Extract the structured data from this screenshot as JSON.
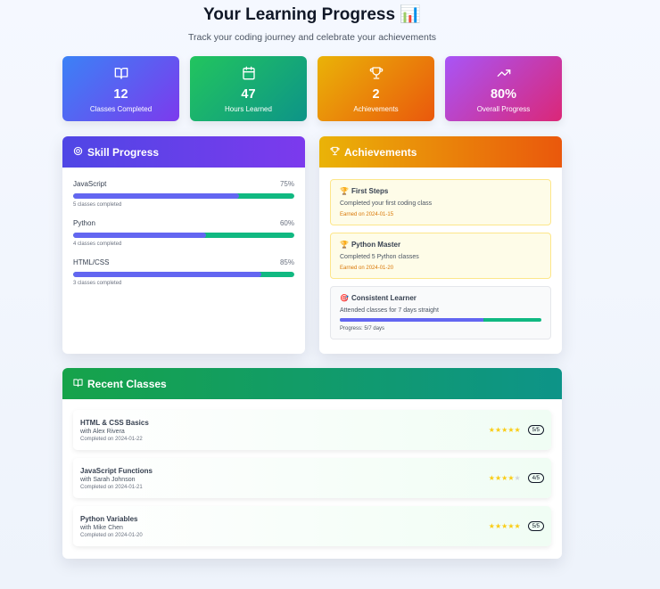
{
  "header": {
    "title": "Your Learning Progress 📊",
    "subtitle": "Track your coding journey and celebrate your achievements"
  },
  "stats": [
    {
      "value": "12",
      "label": "Classes Completed",
      "icon": "book-open-icon"
    },
    {
      "value": "47",
      "label": "Hours Learned",
      "icon": "calendar-icon"
    },
    {
      "value": "2",
      "label": "Achievements",
      "icon": "trophy-icon"
    },
    {
      "value": "80%",
      "label": "Overall Progress",
      "icon": "trending-up-icon"
    }
  ],
  "skills": {
    "title": "Skill Progress",
    "items": [
      {
        "name": "JavaScript",
        "percent_label": "75%",
        "progress": 0.75,
        "note": "5 classes completed"
      },
      {
        "name": "Python",
        "percent_label": "60%",
        "progress": 0.6,
        "note": "4 classes completed"
      },
      {
        "name": "HTML/CSS",
        "percent_label": "85%",
        "progress": 0.85,
        "note": "3 classes completed"
      }
    ]
  },
  "achievements": {
    "title": "Achievements",
    "items": [
      {
        "emoji": "🏆",
        "title": "First Steps",
        "desc": "Completed your first coding class",
        "earned": "Earned on 2024-01-15"
      },
      {
        "emoji": "🏆",
        "title": "Python Master",
        "desc": "Completed 5 Python classes",
        "earned": "Earned on 2024-01-20"
      },
      {
        "emoji": "🎯",
        "title": "Consistent Learner",
        "desc": "Attended classes for 7 days straight",
        "progress_label": "Progress: 5/7 days",
        "progress": 0.714
      }
    ]
  },
  "recent": {
    "title": "Recent Classes",
    "items": [
      {
        "name": "HTML & CSS Basics",
        "teacher": "with Alex Rivera",
        "date": "Completed on 2024-01-22",
        "rating": 5,
        "rating_label": "5/5"
      },
      {
        "name": "JavaScript Functions",
        "teacher": "with Sarah Johnson",
        "date": "Completed on 2024-01-21",
        "rating": 4,
        "rating_label": "4/5"
      },
      {
        "name": "Python Variables",
        "teacher": "with Mike Chen",
        "date": "Completed on 2024-01-20",
        "rating": 5,
        "rating_label": "5/5"
      }
    ]
  },
  "colors": {
    "accent_purple": "#6366f1",
    "accent_green": "#10b981",
    "star": "#facc15"
  }
}
